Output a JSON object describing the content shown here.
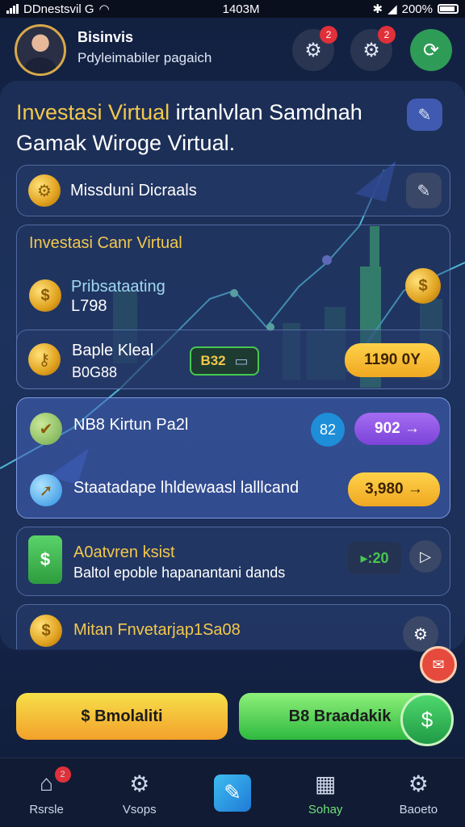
{
  "status_bar": {
    "carrier": "DDnestsvil G",
    "time": "1403M",
    "battery": "200%"
  },
  "header": {
    "user_name": "Bisinvis",
    "user_subtitle": "Pdyleimabiler pagaich",
    "notif_badge": "2",
    "settings_badge": "2"
  },
  "headline": {
    "line1_highlight": "Investasi Virtual",
    "line1_rest": " irtanlvlan Samdnah",
    "line2": "Gamak Wiroge Virtual."
  },
  "mission_card": {
    "label": "Missduni Dicraals"
  },
  "section": {
    "title": "Investasi Canr Virtual",
    "item1_label": "Pribsataating",
    "item1_value": "L798"
  },
  "bank_card": {
    "label": "Baple Kleal",
    "value": "B0G88",
    "chip": "B32",
    "amount": "1190 0Y"
  },
  "active_card": {
    "row1_label": "NB8 Kirtun Pa2l",
    "row1_circle": "82",
    "row1_pill": "902 →",
    "row2_label": "Staatadape lhldewaasl lalllcand",
    "row2_pill": "3,980 →"
  },
  "green_card": {
    "title": "A0atvren ksist",
    "subtitle": "Baltol epoble hapanantani dands",
    "value": "▸:20"
  },
  "last_card": {
    "label": "Mitan Fnvetarjap1Sa08"
  },
  "buttons": {
    "left_label": "$ Bmolaliti",
    "right_label": "B8 Braadakik"
  },
  "nav": [
    {
      "label": "Rsrsle",
      "icon": "home-icon",
      "badge": "2"
    },
    {
      "label": "Vsops",
      "icon": "gear-icon"
    },
    {
      "label": "",
      "icon": "pen-icon"
    },
    {
      "label": "Sohay",
      "icon": "chart-icon"
    },
    {
      "label": "Baoeto",
      "icon": "settings-icon"
    }
  ],
  "colors": {
    "accent_yellow": "#f3c84b",
    "accent_green": "#46c84f",
    "accent_purple": "#8a4fe0",
    "badge_red": "#e0303a"
  }
}
